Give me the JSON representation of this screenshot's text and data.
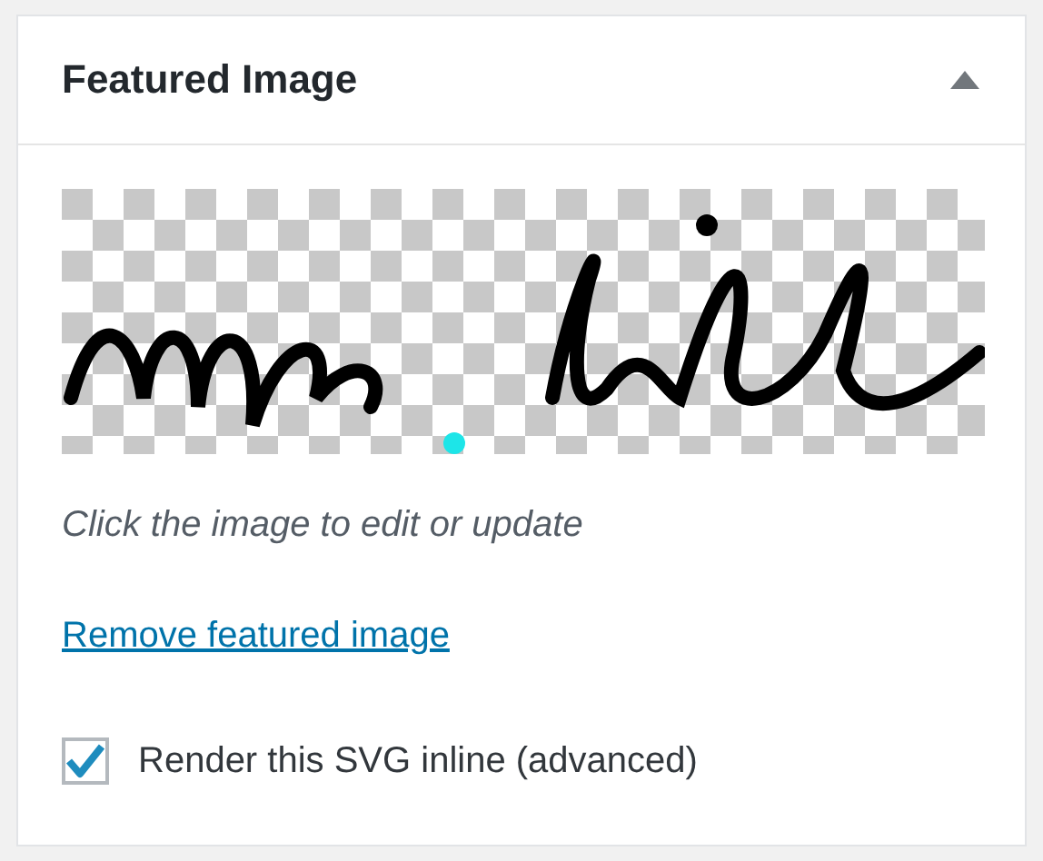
{
  "panel": {
    "title": "Featured Image",
    "expanded": true
  },
  "caption": "Click the image to edit or update",
  "remove_link": "Remove featured image",
  "inline_option": {
    "label": "Render this SVG inline (advanced)",
    "checked": true
  }
}
